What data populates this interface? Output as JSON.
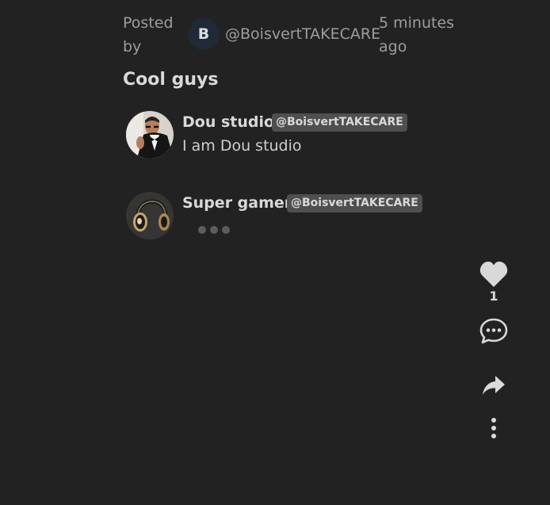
{
  "post": {
    "posted_by_label": "Posted by",
    "author": {
      "avatar_letter": "B",
      "handle": "@BoisvertTAKECARE"
    },
    "time_ago": "5 minutes ago",
    "title": "Cool guys"
  },
  "messages": [
    {
      "name": "Dou studio",
      "tag": "@BoisvertTAKECARE",
      "text": "I am Dou studio",
      "avatar": "man-in-tuxedo-photo"
    },
    {
      "name": "Super gamer",
      "tag": "@BoisvertTAKECARE",
      "typing": true,
      "avatar": "gold-headphones-photo"
    }
  ],
  "actions": {
    "like_count": "1",
    "like_icon": "heart-icon",
    "comment_icon": "comment-icon",
    "share_icon": "share-icon",
    "more_icon": "more-vertical-icon"
  },
  "colors": {
    "background": "#222223",
    "text_primary": "#d9d9d9",
    "text_muted": "#9d9d9d",
    "tag_bg": "#4f4f50",
    "avatar_bg": "#1f2a36"
  }
}
